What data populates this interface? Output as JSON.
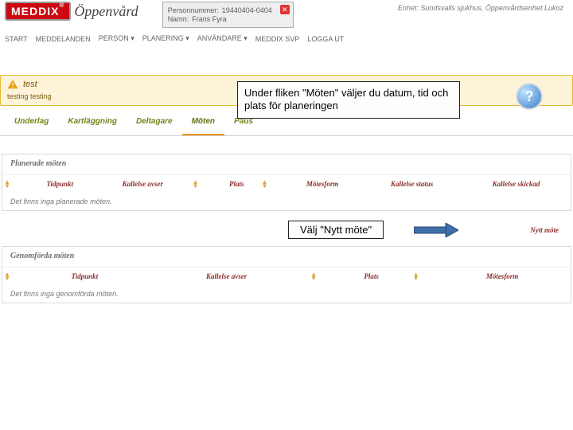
{
  "brand": {
    "name": "MEDDIX",
    "sub": "Öppenvård"
  },
  "patient": {
    "pnr_label": "Personnummer:",
    "pnr_value": "19440404-0404",
    "name_label": "Namn:",
    "name_value": "Frans Fyra"
  },
  "unit": {
    "label": "Enhet:",
    "value": "Sundsvalls sjukhus, Öppenvårdsenhet Lukoz"
  },
  "menu": {
    "start": "START",
    "messages": "MEDDELANDEN",
    "person": "PERSON ▾",
    "planning": "PLANERING ▾",
    "user": "ANVÄNDARE ▾",
    "svp": "MEDDIX SVP",
    "logout": "LOGGA UT"
  },
  "tooltip1": "Under fliken \"Möten\" väljer du datum, tid och plats för planeringen",
  "help_symbol": "?",
  "warn": {
    "title": "test",
    "body": "testing testing"
  },
  "tabs": {
    "t1": "Underlag",
    "t2": "Kartläggning",
    "t3": "Deltagare",
    "t4": "Möten",
    "t5": "Paus"
  },
  "planned": {
    "heading": "Planerade möten",
    "cols": {
      "time": "Tidpunkt",
      "about": "Kallelse avser",
      "place": "Plats",
      "form": "Mötesform",
      "status": "Kallelse status",
      "sent": "Kallelse skickad"
    },
    "empty": "Det finns inga planerade möten."
  },
  "tooltip2": "Välj \"Nytt möte\"",
  "new_meeting": "Nytt möte",
  "done": {
    "heading": "Genomförda möten",
    "cols": {
      "time": "Tidpunkt",
      "about": "Kallelse avser",
      "place": "Plats",
      "form": "Mötesform"
    },
    "empty": "Det finns inga genomförda möten."
  }
}
